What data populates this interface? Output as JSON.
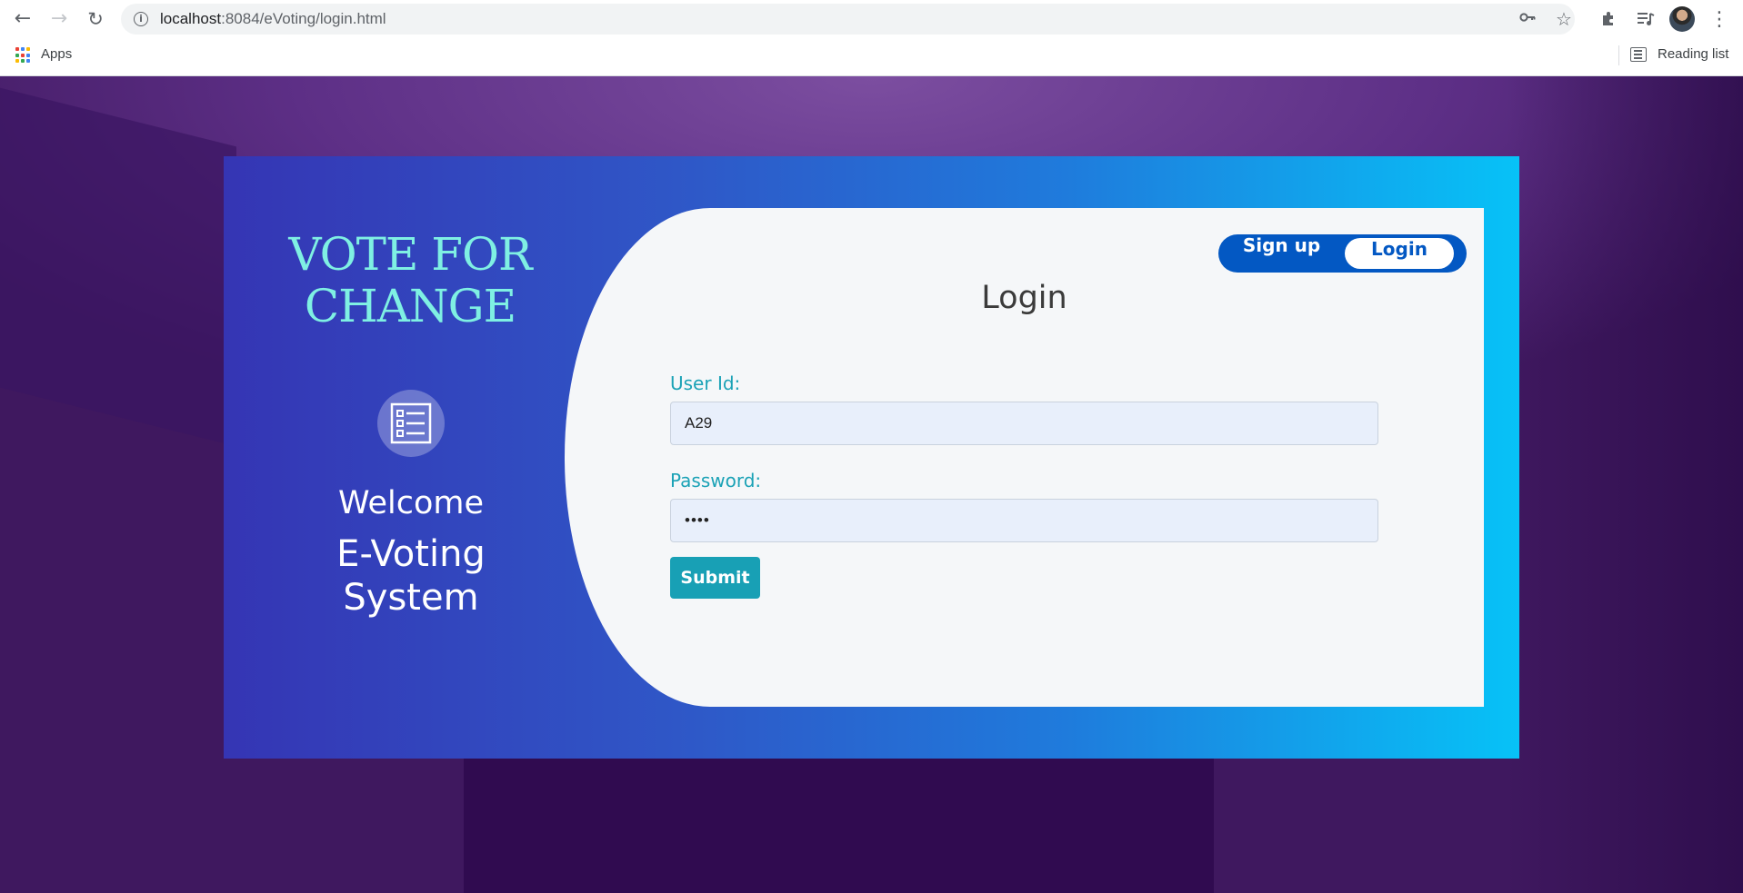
{
  "browser": {
    "url_host": "localhost",
    "url_rest": ":8084/eVoting/login.html",
    "bookmarks": {
      "apps_label": "Apps",
      "reading_list_label": "Reading list"
    }
  },
  "left": {
    "brand_line1": "VOTE FOR",
    "brand_line2": "CHANGE",
    "welcome": "Welcome",
    "system_line1": "E-Voting",
    "system_line2": "System"
  },
  "toggle": {
    "signup_label": "Sign up",
    "login_label": "Login"
  },
  "form": {
    "title": "Login",
    "userid_label": "User Id:",
    "userid_value": "A29",
    "password_label": "Password:",
    "password_value": "••••",
    "submit_label": "Submit"
  },
  "colors": {
    "brand_text": "#7ff0e3",
    "label": "#1ba2b6",
    "toggle_bg": "#0358c3",
    "submit_bg": "#18a0b5"
  }
}
